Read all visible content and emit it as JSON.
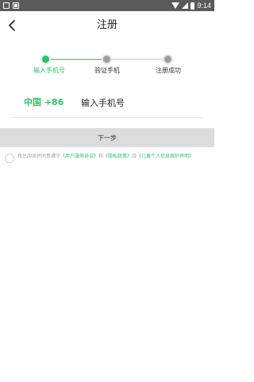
{
  "status_bar": {
    "time": "9:14"
  },
  "header": {
    "title": "注册"
  },
  "steps": [
    {
      "label": "输入手机号",
      "state": "active"
    },
    {
      "label": "验证手机",
      "state": "inactive"
    },
    {
      "label": "注册成功",
      "state": "inactive"
    }
  ],
  "phone": {
    "country_code": "中国 +86",
    "placeholder": "输入手机号",
    "value": ""
  },
  "next_button": {
    "label": "下一步"
  },
  "agreement": {
    "checked": false,
    "prefix": "我已阅读并同意遵守",
    "link_user": "《用户服务协议》",
    "sep_and": "和",
    "link_privacy": "《隐私政策》",
    "sep_and2": "及",
    "link_child": "《儿童个人信息保护声明》"
  },
  "colors": {
    "accent": "#2fc16a",
    "inactive": "#9e9e9e",
    "button_bg": "#dcdcdc",
    "status_bar": "#5a5a5a"
  }
}
